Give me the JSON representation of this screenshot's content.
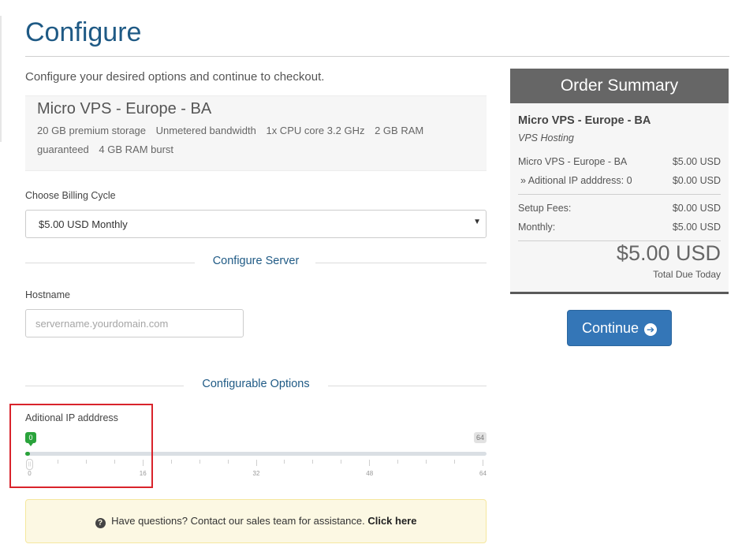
{
  "page": {
    "title": "Configure",
    "intro": "Configure your desired options and continue to checkout."
  },
  "product": {
    "name": "Micro VPS - Europe - BA",
    "features": [
      "20 GB premium storage",
      "Unmetered bandwidth",
      "1x CPU core 3.2 GHz",
      "2 GB RAM guaranteed",
      "4 GB RAM burst"
    ]
  },
  "billing": {
    "label": "Choose Billing Cycle",
    "selected": "$5.00 USD Monthly"
  },
  "configure_server": {
    "heading": "Configure Server",
    "hostname_label": "Hostname",
    "hostname_placeholder": "servername.yourdomain.com",
    "hostname_value": ""
  },
  "configurable_options": {
    "heading": "Configurable Options",
    "ip_label": "Aditional IP adddress",
    "slider": {
      "min": 0,
      "max": 64,
      "value": 0,
      "current_label": "0",
      "max_label": "64",
      "tick_labels": [
        "0",
        "16",
        "32",
        "48",
        "64"
      ],
      "minor_tick_step": 4,
      "color_fill": "#2aa33b"
    }
  },
  "help": {
    "text": "Have questions? Contact our sales team for assistance.",
    "link": "Click here",
    "icon": "question-circle-icon"
  },
  "summary": {
    "title": "Order Summary",
    "product": "Micro VPS - Europe - BA",
    "group": "VPS Hosting",
    "lines": [
      {
        "label": "Micro VPS - Europe - BA",
        "value": "$5.00 USD"
      },
      {
        "label": "» Aditional IP adddress: 0",
        "value": "$0.00 USD"
      }
    ],
    "fees": [
      {
        "label": "Setup Fees:",
        "value": "$0.00 USD"
      },
      {
        "label": "Monthly:",
        "value": "$5.00 USD"
      }
    ],
    "total": "$5.00 USD",
    "total_label": "Total Due Today"
  },
  "continue": {
    "label": "Continue",
    "icon": "arrow-circle-right-icon"
  },
  "colors": {
    "title": "#1f5a85",
    "accent": "#3476b7",
    "highlight": "#d9232b"
  }
}
